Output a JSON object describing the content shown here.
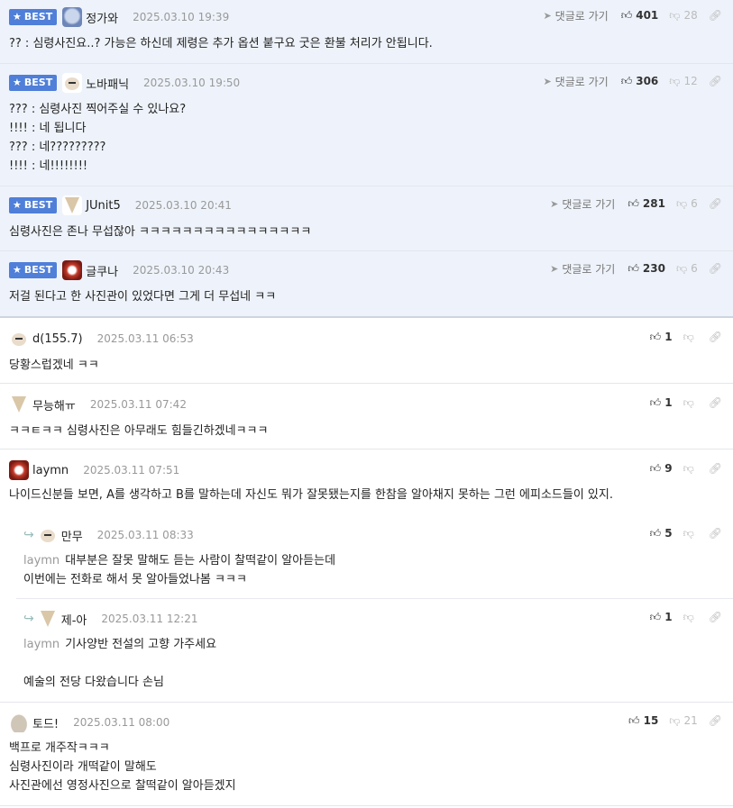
{
  "labels": {
    "best": "BEST",
    "reply_goto": "댓글로 가기"
  },
  "comments": [
    {
      "best": true,
      "nick": "정가와",
      "date": "2025.03.10 19:39",
      "up": "401",
      "down": "28",
      "avatar": "avatar-blue",
      "lines": "?? : 심령사진요..? 가능은 하신데 제령은 추가 옵션 붙구요 굿은 환불 처리가 안됩니다."
    },
    {
      "best": true,
      "nick": "노바패닉",
      "date": "2025.03.10 19:50",
      "up": "306",
      "down": "12",
      "avatar": "avatar-dog",
      "lines": "??? : 심령사진 찍어주실 수 있나요?\n!!!! : 네 됩니다\n??? : 네?????????\n!!!! : 네!!!!!!!!"
    },
    {
      "best": true,
      "nick": "JUnit5",
      "date": "2025.03.10 20:41",
      "up": "281",
      "down": "6",
      "avatar": "avatar-fox",
      "lines": "심령사진은 존나 무섭잖아 ㅋㅋㅋㅋㅋㅋㅋㅋㅋㅋㅋㅋㅋㅋㅋㅋ"
    },
    {
      "best": true,
      "nick": "글쿠나",
      "date": "2025.03.10 20:43",
      "up": "230",
      "down": "6",
      "avatar": "avatar-red",
      "lines": "저걸 된다고 한 사진관이 있었다면 그게 더 무섭네 ㅋㅋ"
    },
    {
      "best": false,
      "nick": "d(155.7)",
      "date": "2025.03.11 06:53",
      "up": "1",
      "down": "",
      "avatar": "avatar-dog",
      "lines": "당황스럽겠네 ㅋㅋ"
    },
    {
      "best": false,
      "nick": "무능해ㅠ",
      "date": "2025.03.11 07:42",
      "up": "1",
      "down": "",
      "avatar": "avatar-fox",
      "lines": "ㅋㅋㅌㅋㅋ 심령사진은 아무래도 힘들긴하겠네ㅋㅋㅋ"
    },
    {
      "best": false,
      "nick": "laymn",
      "date": "2025.03.11 07:51",
      "up": "9",
      "down": "",
      "avatar": "avatar-red",
      "lines": "나이드신분들 보면, A를 생각하고 B를 말하는데 자신도 뭐가 잘못됐는지를 한참을 알아채지 못하는 그런 에피소드들이 있지."
    },
    {
      "best": false,
      "sub": true,
      "nick": "만무",
      "date": "2025.03.11 08:33",
      "up": "5",
      "down": "",
      "avatar": "avatar-dog",
      "mention": "laymn",
      "lines": "대부분은 잘못 말해도 듣는 사람이 찰떡같이 알아듣는데\n이번에는 전화로 해서 못 알아들었나봄 ㅋㅋㅋ"
    },
    {
      "best": false,
      "sub": true,
      "nick": "제-아",
      "date": "2025.03.11 12:21",
      "up": "1",
      "down": "",
      "avatar": "avatar-fox",
      "mention": "laymn",
      "lines": "기사양반 전설의 고향 가주세요\n\n예술의 전당 다왔습니다 손님"
    },
    {
      "best": false,
      "nick": "토드!",
      "date": "2025.03.11 08:00",
      "up": "15",
      "down": "21",
      "avatar": "avatar-blob",
      "lines": "백프로 개주작ㅋㅋㅋ\n심령사진이라 개떡같이 말해도\n사진관에선 영정사진으로 찰떡같이 알아듣겠지"
    }
  ]
}
